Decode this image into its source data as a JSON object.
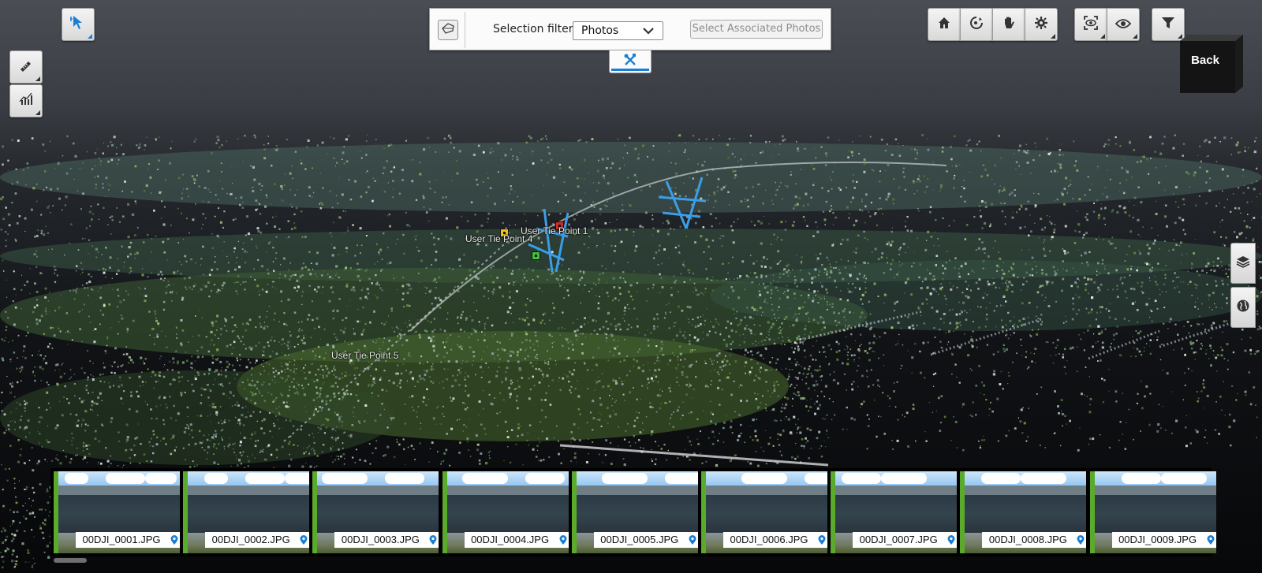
{
  "toolbar_left": {
    "select_tool_icon": "cursor-select-icon",
    "measure_tool_icon": "ruler-icon",
    "profile_tool_icon": "profile-chart-icon"
  },
  "selection_filter": {
    "label": "Selection filter:",
    "selected": "Photos",
    "associated_button": "Select Associated Photos",
    "tab_icon": "tools-icon"
  },
  "toolbar_right": {
    "group1": [
      "home-icon",
      "orbit-icon",
      "pan-hand-icon",
      "settings-gear-icon"
    ],
    "group2": [
      "view-mode-icon",
      "visibility-eye-icon"
    ],
    "group3": [
      "filter-funnel-icon"
    ]
  },
  "view_cube": {
    "face_label": "Back"
  },
  "side_buttons": [
    "layers-icon",
    "globe-icon"
  ],
  "tie_points": [
    {
      "label": "User Tie Point 1",
      "color": "#d12a2a"
    },
    {
      "label": "User Tie Point 4",
      "color": "#e9c51a"
    },
    {
      "label": "User Tie Point 5",
      "color": "#3fbf3a"
    }
  ],
  "photos": [
    {
      "name": "00DJI_0001.JPG"
    },
    {
      "name": "00DJI_0002.JPG"
    },
    {
      "name": "00DJI_0003.JPG"
    },
    {
      "name": "00DJI_0004.JPG"
    },
    {
      "name": "00DJI_0005.JPG"
    },
    {
      "name": "00DJI_0006.JPG"
    },
    {
      "name": "00DJI_0007.JPG"
    },
    {
      "name": "00DJI_0008.JPG"
    },
    {
      "name": "00DJI_0009.JPG"
    }
  ],
  "colors": {
    "accent": "#1a7fd4",
    "thumb_border": "#5aaa2c"
  }
}
